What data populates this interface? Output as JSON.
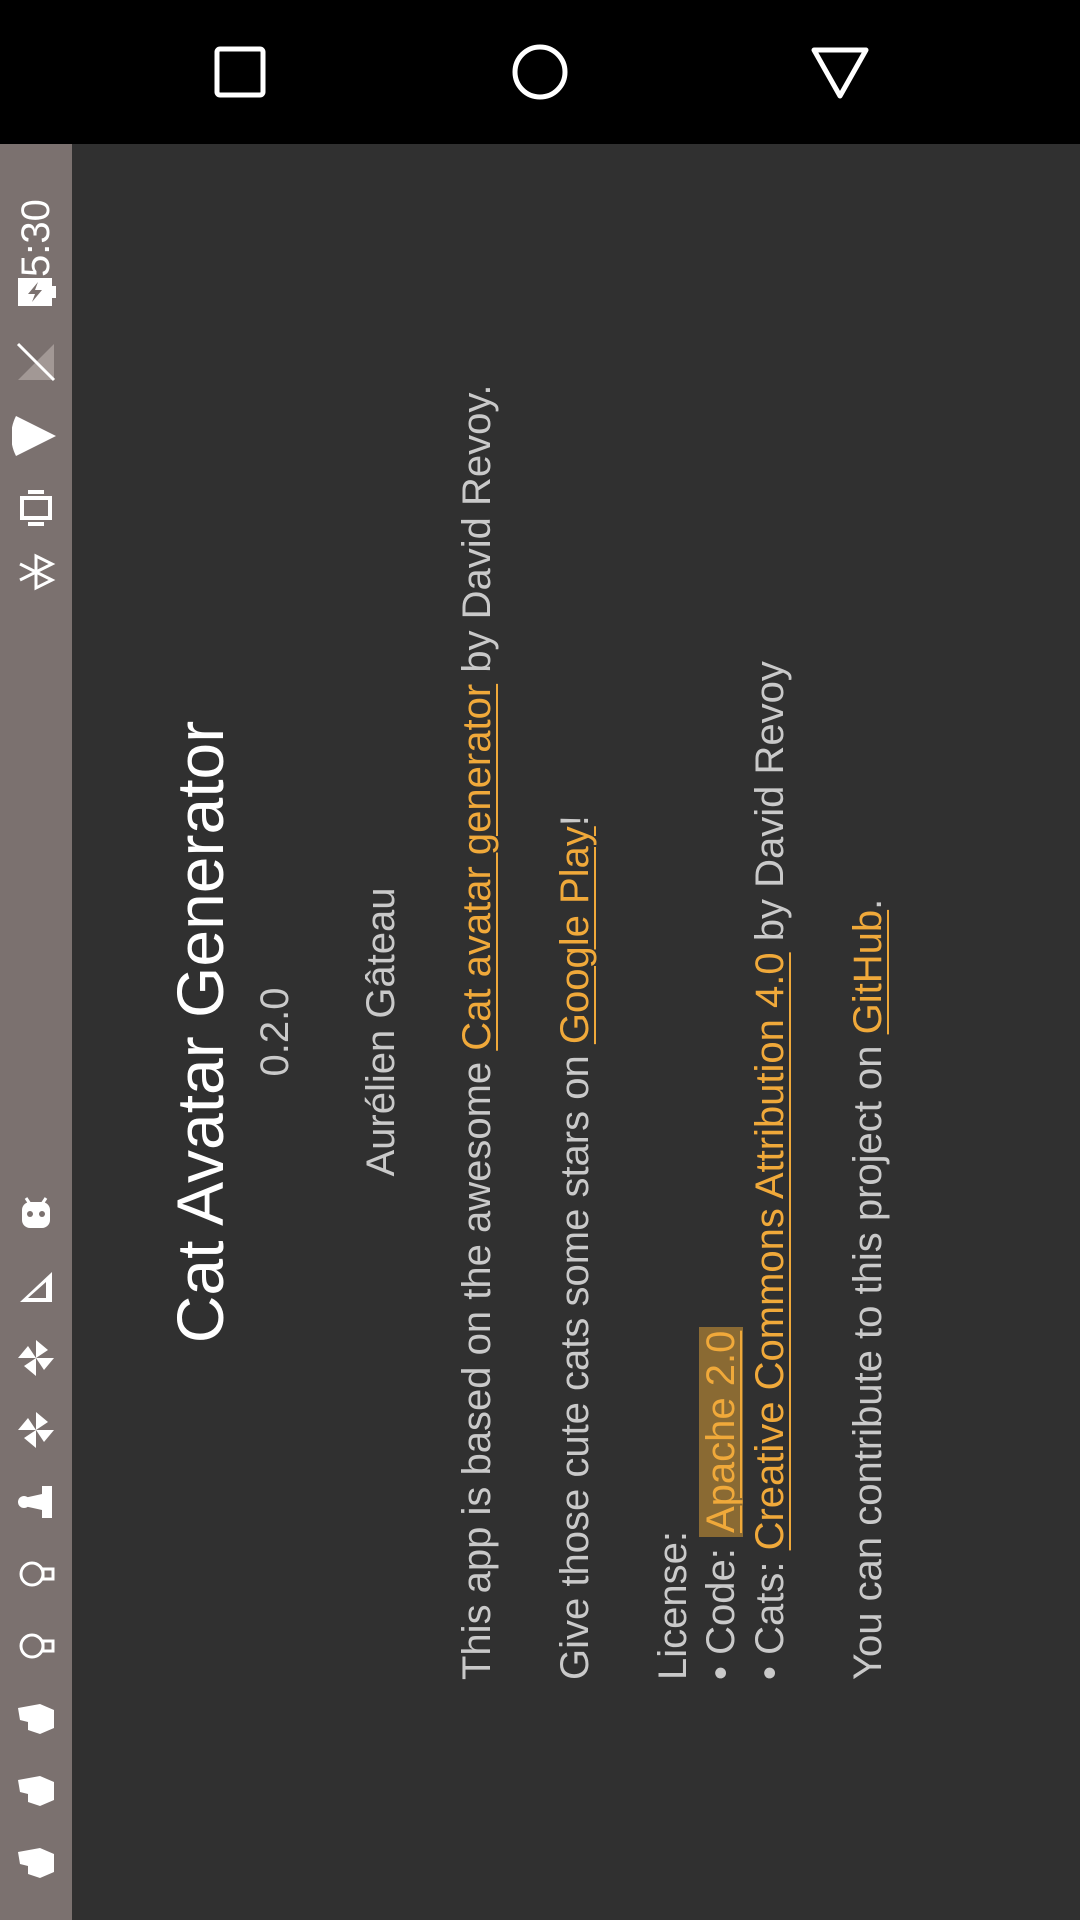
{
  "nav": {
    "recents_icon": "square-icon",
    "home_icon": "circle-icon",
    "back_icon": "triangle-icon"
  },
  "status_bar": {
    "time": "5:30",
    "icons": [
      "battery-charging-icon",
      "signal-off-icon",
      "wifi-icon",
      "vibrate-icon",
      "bluetooth-icon",
      "android-icon",
      "feather-icon",
      "pinwheel-icon",
      "pinwheel-icon",
      "chess-piece-icon",
      "bulb-icon",
      "bulb-icon",
      "hand-icon",
      "hand-icon",
      "hand-icon"
    ]
  },
  "about": {
    "title": "Cat Avatar Generator",
    "version": "0.2.0",
    "author": "Aurélien Gâteau",
    "based_on_prefix": "This app is based on the awesome ",
    "based_on_link": "Cat avatar generator",
    "based_on_suffix": " by David Revoy.",
    "stars_prefix": "Give those cute cats some stars on ",
    "stars_link": "Google Play",
    "stars_suffix": "!",
    "license_label": "License:",
    "code_prefix": "• Code: ",
    "code_link": "Apache 2.0",
    "cats_prefix": "• Cats: ",
    "cats_link": "Creative Commons Attribution 4.0",
    "cats_suffix": " by David Revoy",
    "contribute_prefix": "You can contribute to this project on ",
    "contribute_link": "GitHub",
    "contribute_suffix": "."
  },
  "colors": {
    "background": "#303030",
    "status_bar": "#7b716f",
    "nav_bar": "#000000",
    "link": "#f0a93a",
    "text": "#c9c9c9"
  }
}
